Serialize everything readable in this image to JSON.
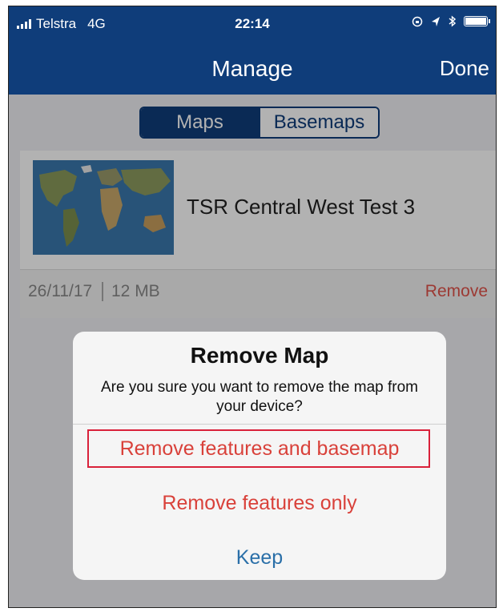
{
  "status_bar": {
    "carrier": "Telstra",
    "network": "4G",
    "time": "22:14"
  },
  "nav": {
    "title": "Manage",
    "done_label": "Done"
  },
  "segments": {
    "maps_label": "Maps",
    "basemaps_label": "Basemaps",
    "selected": "Maps"
  },
  "map_card": {
    "name": "TSR Central West Test 3",
    "date": "26/11/17",
    "size": "12 MB",
    "remove_label": "Remove"
  },
  "alert": {
    "title": "Remove Map",
    "message": "Are you sure you want to remove the map from your device?",
    "button_remove_all": "Remove features and basemap",
    "button_remove_features": "Remove features only",
    "button_keep": "Keep"
  },
  "colors": {
    "nav_blue": "#0f3d7a",
    "destructive_red": "#d9413a",
    "keep_blue": "#2a6fa8",
    "highlight_border": "#d9213a"
  }
}
